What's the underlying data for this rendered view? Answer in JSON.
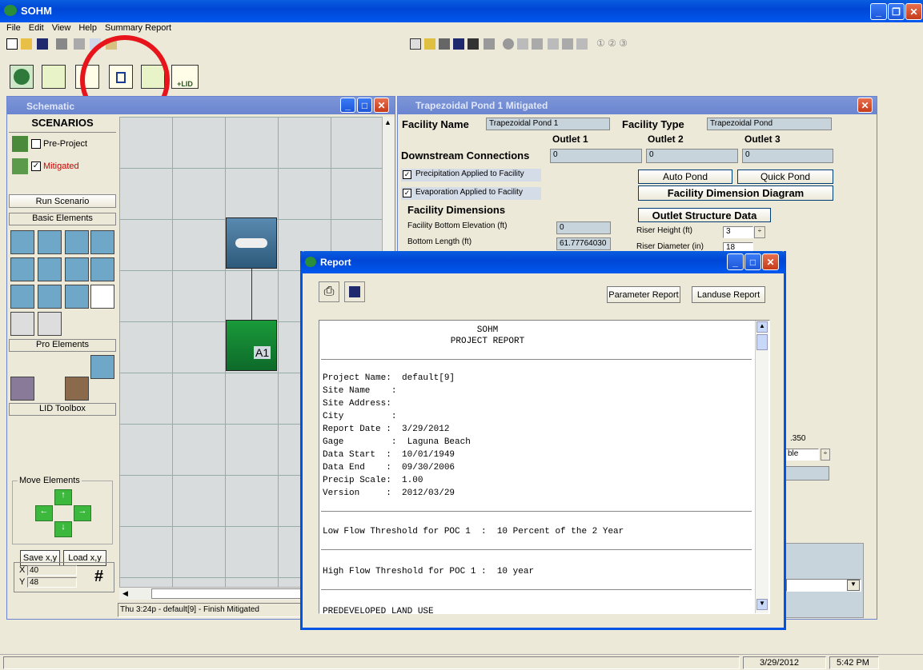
{
  "app": {
    "title": "SOHM"
  },
  "menu": [
    "File",
    "Edit",
    "View",
    "Help",
    "Summary Report"
  ],
  "statusbar": {
    "date": "3/29/2012",
    "time": "5:42 PM"
  },
  "schematic": {
    "title": "Schematic",
    "scenarios_header": "SCENARIOS",
    "pre_project": "Pre-Project",
    "mitigated": "Mitigated",
    "run_scenario": "Run Scenario",
    "basic_elements": "Basic Elements",
    "pro_elements": "Pro Elements",
    "lid_toolbox": "LID Toolbox",
    "move_elements": "Move Elements",
    "save_xy": "Save x,y",
    "load_xy": "Load x,y",
    "x_label": "X",
    "x_value": "40",
    "y_label": "Y",
    "y_value": "48",
    "status_text": "Thu 3:24p - default[9] - Finish Mitigated",
    "hash": "#",
    "node_label": "A1"
  },
  "facility": {
    "window_title": "Trapezoidal Pond  1 Mitigated",
    "facility_name_label": "Facility Name",
    "facility_name_value": "Trapezoidal Pond 1",
    "facility_type_label": "Facility Type",
    "facility_type_value": "Trapezoidal Pond",
    "outlet1": "Outlet 1",
    "outlet2": "Outlet 2",
    "outlet3": "Outlet 3",
    "downstream_label": "Downstream Connections",
    "ds1": "0",
    "ds2": "0",
    "ds3": "0",
    "precip": "Precipitation Applied to Facility",
    "evap": "Evaporation Applied to Facility",
    "auto_pond": "Auto Pond",
    "quick_pond": "Quick Pond",
    "dimension_diagram": "Facility Dimension Diagram",
    "dimensions_header": "Facility Dimensions",
    "outlet_structure": "Outlet Structure Data",
    "bottom_elev_label": "Facility Bottom Elevation (ft)",
    "bottom_elev_value": "0",
    "bottom_length_label": "Bottom Length (ft)",
    "bottom_length_value": "61.77764030",
    "riser_height_label": "Riser Height (ft)",
    "riser_height_value": "3",
    "riser_diameter_label": "Riser Diameter (in)",
    "riser_diameter_value": "18",
    "partial_350": ".350",
    "partial_ble": "ble"
  },
  "report": {
    "title": "Report",
    "param_button": "Parameter Report",
    "landuse_button": "Landuse Report",
    "lines": {
      "h1": "SOHM",
      "h2": "PROJECT REPORT",
      "l1": "Project Name:  default[9]",
      "l2": "Site Name    :",
      "l3": "Site Address:",
      "l4": "City         :",
      "l5": "Report Date :  3/29/2012",
      "l6": "Gage         :  Laguna Beach",
      "l7": "Data Start  :  10/01/1949",
      "l8": "Data End    :  09/30/2006",
      "l9": "Precip Scale:  1.00",
      "l10": "Version     :  2012/03/29",
      "low": "Low Flow Threshold for POC 1  :  10 Percent of the 2 Year",
      "high": "High Flow Threshold for POC 1 :  10 year",
      "pre": "PREDEVELOPED LAND USE"
    }
  },
  "colors": {
    "highlight_circle": "#e8141b",
    "xp_blue": "#0054e3"
  }
}
